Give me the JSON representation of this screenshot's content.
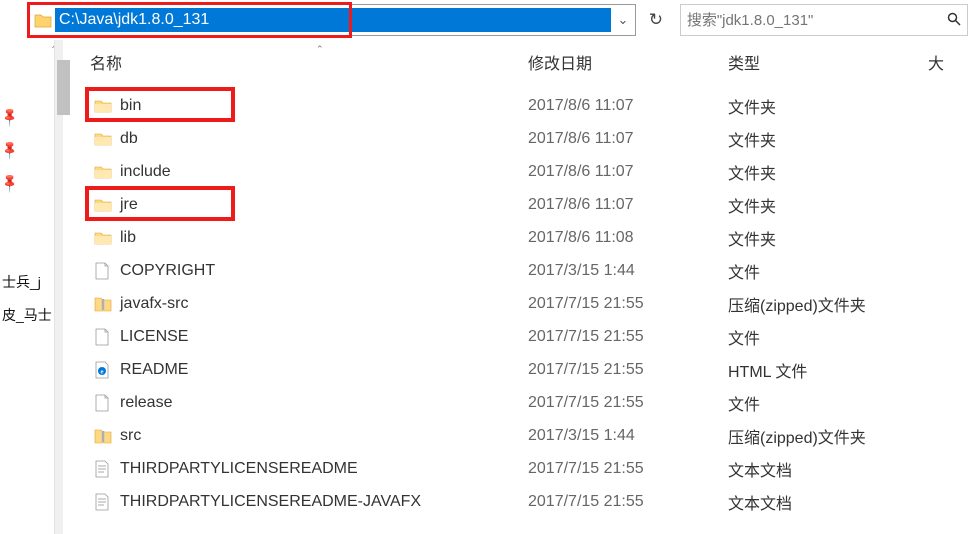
{
  "address": {
    "path": "C:\\Java\\jdk1.8.0_131"
  },
  "search": {
    "placeholder": "搜索\"jdk1.8.0_131\""
  },
  "columns": {
    "name": "名称",
    "date": "修改日期",
    "type": "类型",
    "size": "大"
  },
  "quickAccess": {
    "items": [
      {
        "label": "",
        "pin": true
      },
      {
        "label": "",
        "pin": true
      },
      {
        "label": "",
        "pin": true
      },
      {
        "label": "",
        "pin": false
      },
      {
        "label": "",
        "pin": false
      },
      {
        "label": "士兵_j",
        "pin": false
      },
      {
        "label": "皮_马士",
        "pin": false
      },
      {
        "label": "",
        "pin": false
      }
    ]
  },
  "files": [
    {
      "icon": "folder",
      "name": "bin",
      "date": "2017/8/6 11:07",
      "type": "文件夹",
      "highlight": true
    },
    {
      "icon": "folder",
      "name": "db",
      "date": "2017/8/6 11:07",
      "type": "文件夹",
      "highlight": false
    },
    {
      "icon": "folder",
      "name": "include",
      "date": "2017/8/6 11:07",
      "type": "文件夹",
      "highlight": false
    },
    {
      "icon": "folder",
      "name": "jre",
      "date": "2017/8/6 11:07",
      "type": "文件夹",
      "highlight": true
    },
    {
      "icon": "folder",
      "name": "lib",
      "date": "2017/8/6 11:08",
      "type": "文件夹",
      "highlight": false
    },
    {
      "icon": "file",
      "name": "COPYRIGHT",
      "date": "2017/3/15 1:44",
      "type": "文件",
      "highlight": false
    },
    {
      "icon": "zip",
      "name": "javafx-src",
      "date": "2017/7/15 21:55",
      "type": "压缩(zipped)文件夹",
      "highlight": false
    },
    {
      "icon": "file",
      "name": "LICENSE",
      "date": "2017/7/15 21:55",
      "type": "文件",
      "highlight": false
    },
    {
      "icon": "html",
      "name": "README",
      "date": "2017/7/15 21:55",
      "type": "HTML 文件",
      "highlight": false
    },
    {
      "icon": "file",
      "name": "release",
      "date": "2017/7/15 21:55",
      "type": "文件",
      "highlight": false
    },
    {
      "icon": "zip",
      "name": "src",
      "date": "2017/3/15 1:44",
      "type": "压缩(zipped)文件夹",
      "highlight": false
    },
    {
      "icon": "text",
      "name": "THIRDPARTYLICENSEREADME",
      "date": "2017/7/15 21:55",
      "type": "文本文档",
      "highlight": false
    },
    {
      "icon": "text",
      "name": "THIRDPARTYLICENSEREADME-JAVAFX",
      "date": "2017/7/15 21:55",
      "type": "文本文档",
      "highlight": false
    }
  ]
}
